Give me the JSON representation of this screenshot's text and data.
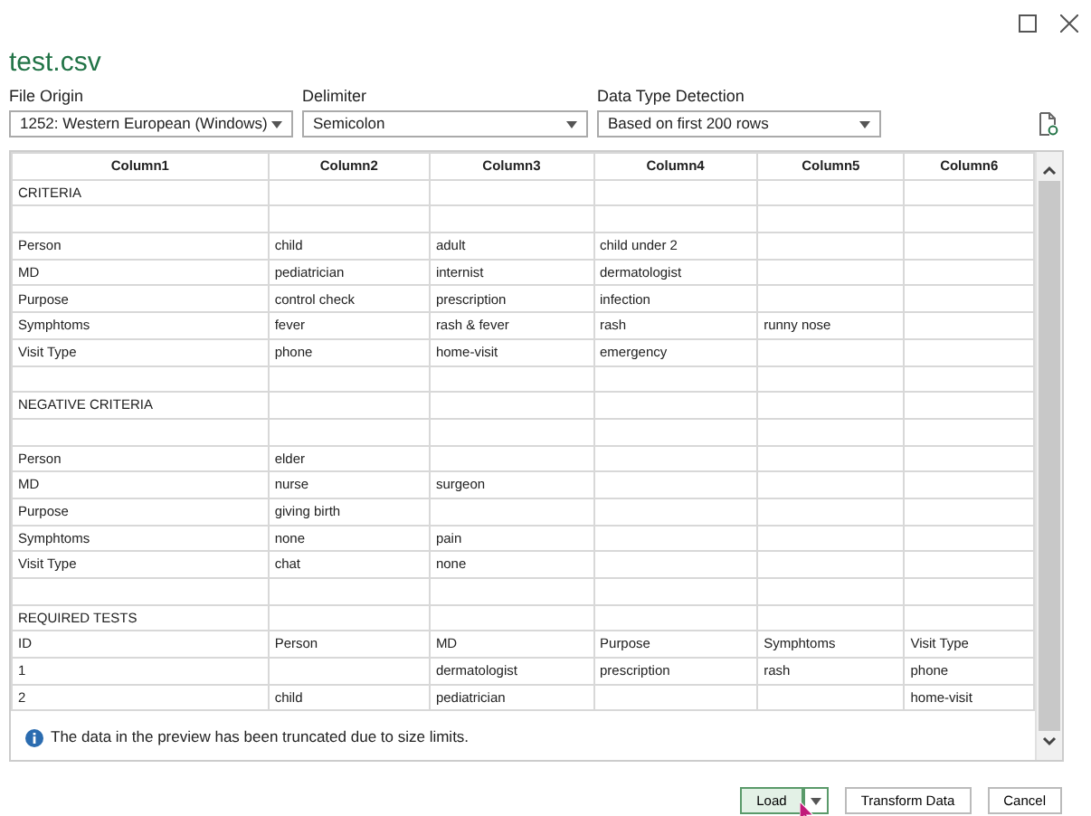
{
  "window": {
    "title": "test.csv"
  },
  "options": [
    {
      "label": "File Origin",
      "value": "1252: Western European (Windows)"
    },
    {
      "label": "Delimiter",
      "value": "Semicolon"
    },
    {
      "label": "Data Type Detection",
      "value": "Based on first 200 rows"
    }
  ],
  "table": {
    "columns": [
      "Column1",
      "Column2",
      "Column3",
      "Column4",
      "Column5",
      "Column6"
    ],
    "rows": [
      [
        "CRITERIA",
        null,
        null,
        null,
        null,
        null
      ],
      [
        null,
        null,
        null,
        null,
        null,
        null
      ],
      [
        "Person",
        "child",
        "adult",
        "child under 2",
        null,
        null
      ],
      [
        "MD",
        "pediatrician",
        "internist",
        "dermatologist",
        null,
        null
      ],
      [
        "Purpose",
        "control check",
        "prescription",
        "infection",
        null,
        null
      ],
      [
        "Symphtoms",
        "fever",
        "rash & fever",
        "rash",
        "runny nose",
        null
      ],
      [
        "Visit Type",
        "phone",
        "home-visit",
        "emergency",
        null,
        null
      ],
      [
        null,
        null,
        null,
        null,
        null,
        null
      ],
      [
        "NEGATIVE CRITERIA",
        null,
        null,
        null,
        null,
        null
      ],
      [
        null,
        null,
        null,
        null,
        null,
        null
      ],
      [
        "Person",
        "elder",
        null,
        null,
        null,
        null
      ],
      [
        "MD",
        "nurse",
        "surgeon",
        null,
        null,
        null
      ],
      [
        "Purpose",
        "giving birth",
        null,
        null,
        null,
        null
      ],
      [
        "Symphtoms",
        "none",
        "pain",
        null,
        null,
        null
      ],
      [
        "Visit Type",
        "chat",
        "none",
        null,
        null,
        null
      ],
      [
        null,
        null,
        null,
        null,
        null,
        null
      ],
      [
        "REQUIRED TESTS",
        null,
        null,
        null,
        null,
        null
      ],
      [
        "ID",
        "Person",
        "MD",
        "Purpose",
        "Symphtoms",
        "Visit Type"
      ],
      [
        "1",
        null,
        "dermatologist",
        "prescription",
        "rash",
        "phone"
      ],
      [
        "2",
        "child",
        "pediatrician",
        null,
        null,
        "home-visit"
      ]
    ]
  },
  "notice": "The data in the preview has been truncated due to size limits.",
  "buttons": [
    {
      "label": "Load",
      "default": true,
      "split": true
    },
    {
      "label": "Transform Data",
      "default": false,
      "split": false
    },
    {
      "label": "Cancel",
      "default": false,
      "split": false
    }
  ]
}
